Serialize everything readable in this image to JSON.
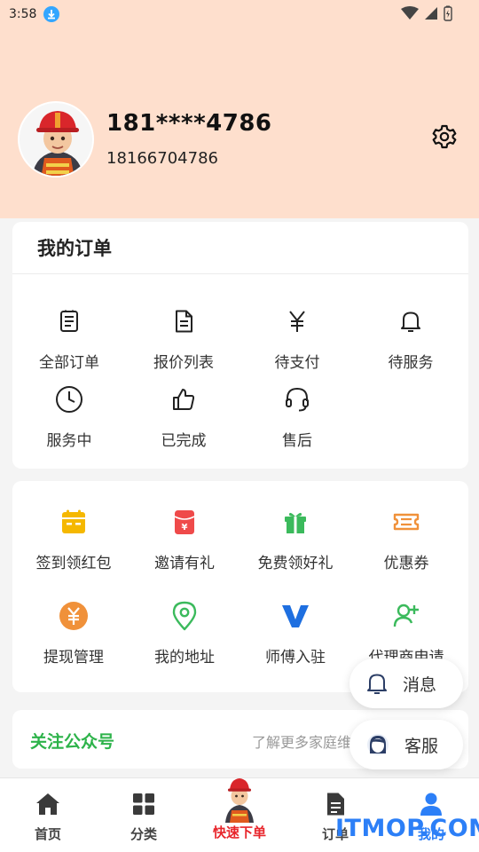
{
  "status_bar": {
    "time": "3:58"
  },
  "profile": {
    "name": "181****4786",
    "phone": "18166704786"
  },
  "orders": {
    "title": "我的订单",
    "items": [
      {
        "label": "全部订单",
        "icon": "order-list-icon"
      },
      {
        "label": "报价列表",
        "icon": "document-icon"
      },
      {
        "label": "待支付",
        "icon": "yen-icon"
      },
      {
        "label": "待服务",
        "icon": "bell-icon"
      },
      {
        "label": "服务中",
        "icon": "clock-icon"
      },
      {
        "label": "已完成",
        "icon": "thumbs-up-icon"
      },
      {
        "label": "售后",
        "icon": "headset-icon"
      }
    ]
  },
  "tools": {
    "items": [
      {
        "label": "签到领红包",
        "icon": "calendar-icon",
        "color": "#f5b800"
      },
      {
        "label": "邀请有礼",
        "icon": "red-envelope-icon",
        "color": "#ef4a4a"
      },
      {
        "label": "免费领好礼",
        "icon": "gift-icon",
        "color": "#3bba5c"
      },
      {
        "label": "优惠券",
        "icon": "coupon-icon",
        "color": "#f0913a"
      },
      {
        "label": "提现管理",
        "icon": "withdraw-icon",
        "color": "#f0913a"
      },
      {
        "label": "我的地址",
        "icon": "location-pin-icon",
        "color": "#3bba5c"
      },
      {
        "label": "师傅入驻",
        "icon": "v-badge-icon",
        "color": "#1e6fe0"
      },
      {
        "label": "代理商申请",
        "icon": "add-user-icon",
        "color": "#3bba5c"
      }
    ]
  },
  "follow": {
    "title": "关注公众号",
    "subtitle": "了解更多家庭维修"
  },
  "floating": {
    "message": "消息",
    "service": "客服"
  },
  "tabbar": {
    "items": [
      {
        "label": "首页",
        "icon": "home-icon"
      },
      {
        "label": "分类",
        "icon": "category-grid-icon"
      },
      {
        "label": "快速下单",
        "icon": "mascot-icon"
      },
      {
        "label": "订单",
        "icon": "order-doc-icon"
      },
      {
        "label": "我的",
        "icon": "user-icon"
      }
    ]
  },
  "watermark": "ITMOP.COM",
  "colors": {
    "header_bg": "#fedfcd",
    "accent_green": "#2db34a",
    "tab_active": "#2c7ff7",
    "center_red": "#e8262c"
  }
}
